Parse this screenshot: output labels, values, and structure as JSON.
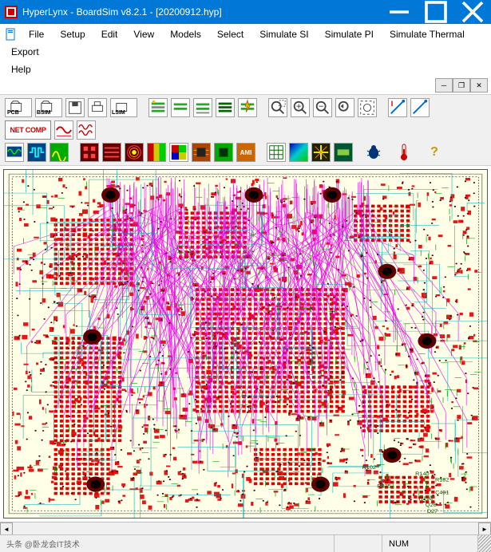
{
  "window": {
    "title": "HyperLynx - BoardSim v8.2.1 - [20200912.hyp]"
  },
  "menu": {
    "file": "File",
    "setup": "Setup",
    "edit": "Edit",
    "view": "View",
    "models": "Models",
    "select": "Select",
    "simulate_si": "Simulate SI",
    "simulate_pi": "Simulate PI",
    "simulate_thermal": "Simulate Thermal",
    "export": "Export",
    "help": "Help"
  },
  "toolbar_row1": {
    "pcb": "PCB",
    "bsim": "BSIM",
    "lsim": "LSIM",
    "net_comp": "NET COMP"
  },
  "statusbar": {
    "num": "NUM",
    "watermark": "头条 @卧龙会IT技术"
  },
  "colors": {
    "titlebar": "#0078d7",
    "canvas_bg": "#ffffe8",
    "copper": "#e00000",
    "silk": "#00a000",
    "route1": "#e000e0",
    "route2": "#00b0b0",
    "via": "#600000",
    "pad_dark": "#000000"
  }
}
